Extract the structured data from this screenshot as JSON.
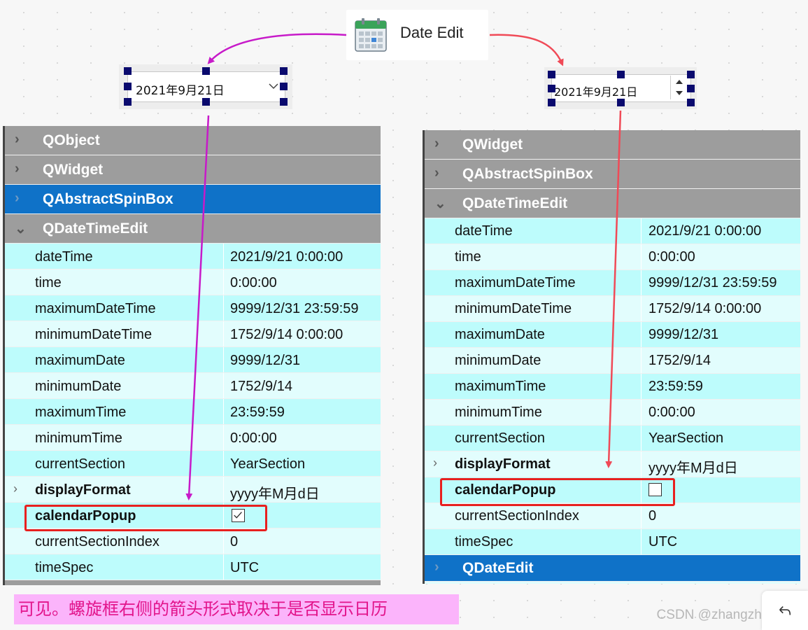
{
  "toolbox": {
    "item_label": "Date Edit",
    "icon": "calendar-icon"
  },
  "left_widget": {
    "value": "2021年9月21日",
    "arrow_icon": "chevron-down-icon"
  },
  "right_widget": {
    "value": "2021年9月21日",
    "spin_icons": [
      "spin-up-icon",
      "spin-down-icon"
    ]
  },
  "left_panel": {
    "categories": {
      "qobject": "QObject",
      "qwidget": "QWidget",
      "qabstractspinbox": "QAbstractSpinBox",
      "qdatetimeedit": "QDateTimeEdit"
    },
    "properties": [
      {
        "name": "dateTime",
        "value": "2021/9/21 0:00:00"
      },
      {
        "name": "time",
        "value": "0:00:00"
      },
      {
        "name": "maximumDateTime",
        "value": "9999/12/31 23:59:59"
      },
      {
        "name": "minimumDateTime",
        "value": "1752/9/14 0:00:00"
      },
      {
        "name": "maximumDate",
        "value": "9999/12/31"
      },
      {
        "name": "minimumDate",
        "value": "1752/9/14"
      },
      {
        "name": "maximumTime",
        "value": "23:59:59"
      },
      {
        "name": "minimumTime",
        "value": "0:00:00"
      },
      {
        "name": "currentSection",
        "value": "YearSection"
      },
      {
        "name": "displayFormat",
        "value": "yyyy年M月d日"
      },
      {
        "name": "calendarPopup",
        "value": "",
        "checked": true
      },
      {
        "name": "currentSectionIndex",
        "value": "0"
      },
      {
        "name": "timeSpec",
        "value": "UTC"
      }
    ]
  },
  "right_panel": {
    "categories": {
      "qwidget": "QWidget",
      "qabstractspinbox": "QAbstractSpinBox",
      "qdatetimeedit": "QDateTimeEdit",
      "qdateedit": "QDateEdit"
    },
    "properties": [
      {
        "name": "dateTime",
        "value": "2021/9/21 0:00:00"
      },
      {
        "name": "time",
        "value": "0:00:00"
      },
      {
        "name": "maximumDateTime",
        "value": "9999/12/31 23:59:59"
      },
      {
        "name": "minimumDateTime",
        "value": "1752/9/14 0:00:00"
      },
      {
        "name": "maximumDate",
        "value": "9999/12/31"
      },
      {
        "name": "minimumDate",
        "value": "1752/9/14"
      },
      {
        "name": "maximumTime",
        "value": "23:59:59"
      },
      {
        "name": "minimumTime",
        "value": "0:00:00"
      },
      {
        "name": "currentSection",
        "value": "YearSection"
      },
      {
        "name": "displayFormat",
        "value": "yyyy年M月d日"
      },
      {
        "name": "calendarPopup",
        "value": "",
        "checked": false
      },
      {
        "name": "currentSectionIndex",
        "value": "0"
      },
      {
        "name": "timeSpec",
        "value": "UTC"
      }
    ]
  },
  "annotation": {
    "note": "可见。螺旋框右侧的箭头形式取决于是否显示日历",
    "watermark": "CSDN @zhangzhangkeji"
  },
  "colors": {
    "category_gray": "#9d9d9d",
    "category_selected": "#0f72c8",
    "row_alt": "#bdfcfc",
    "row_plain": "#e2fdfd",
    "highlight_red": "#e8201f",
    "arrow_magenta": "#c71ac9",
    "arrow_red": "#f04a57",
    "note_bg": "#fbb4fb",
    "note_text": "#e2148b"
  }
}
